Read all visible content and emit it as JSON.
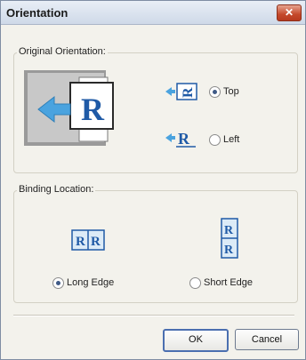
{
  "window": {
    "title": "Orientation",
    "close_icon": "close-icon"
  },
  "original_orientation": {
    "legend": "Original Orientation:",
    "options": [
      {
        "label": "Top",
        "checked": true
      },
      {
        "label": "Left",
        "checked": false
      }
    ],
    "glyph_letter": "R"
  },
  "binding_location": {
    "legend": "Binding Location:",
    "options": [
      {
        "label": "Long Edge",
        "checked": true
      },
      {
        "label": "Short Edge",
        "checked": false
      }
    ]
  },
  "buttons": {
    "ok": "OK",
    "cancel": "Cancel"
  },
  "colors": {
    "accent": "#1f5aa6",
    "arrow": "#4aa3df",
    "close": "#c5492b"
  }
}
